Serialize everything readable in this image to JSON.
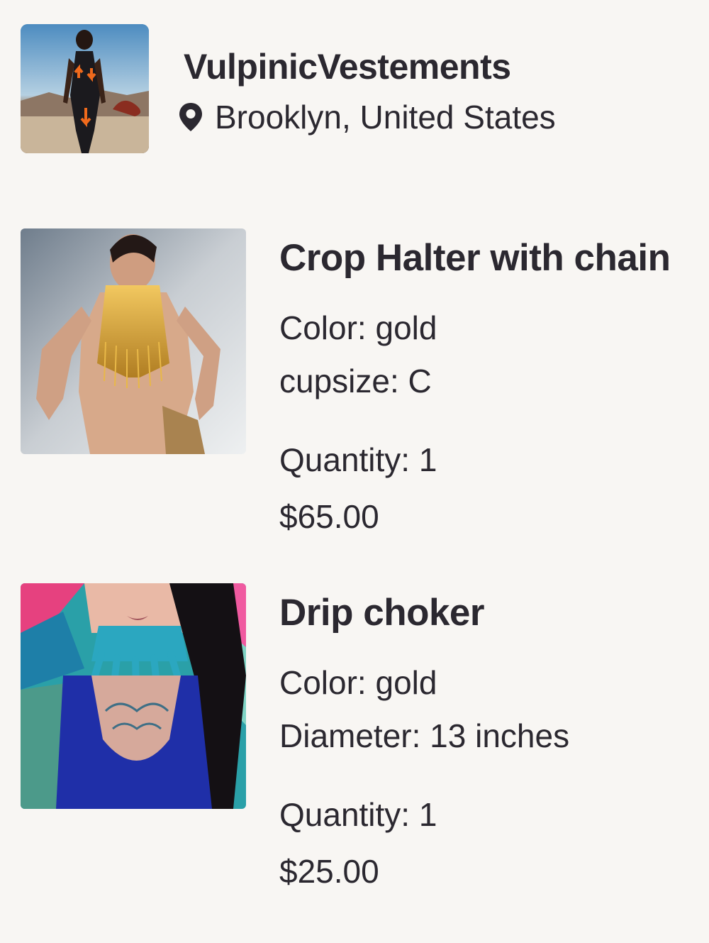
{
  "shop": {
    "name": "VulpinicVestements",
    "location": "Brooklyn, United States",
    "avatar_icon": "shop-avatar-photo",
    "location_icon": "map-pin-icon"
  },
  "items": [
    {
      "title": "Crop Halter with chain",
      "variations": [
        "Color: gold",
        "cupsize: C"
      ],
      "quantity": "Quantity: 1",
      "price": "$65.00",
      "photo_icon": "listing-photo"
    },
    {
      "title": "Drip choker",
      "variations": [
        "Color: gold",
        "Diameter: 13 inches"
      ],
      "quantity": "Quantity: 1",
      "price": "$25.00",
      "photo_icon": "listing-photo"
    }
  ],
  "colors": {
    "background": "#f8f6f3",
    "text": "#2b2830"
  }
}
